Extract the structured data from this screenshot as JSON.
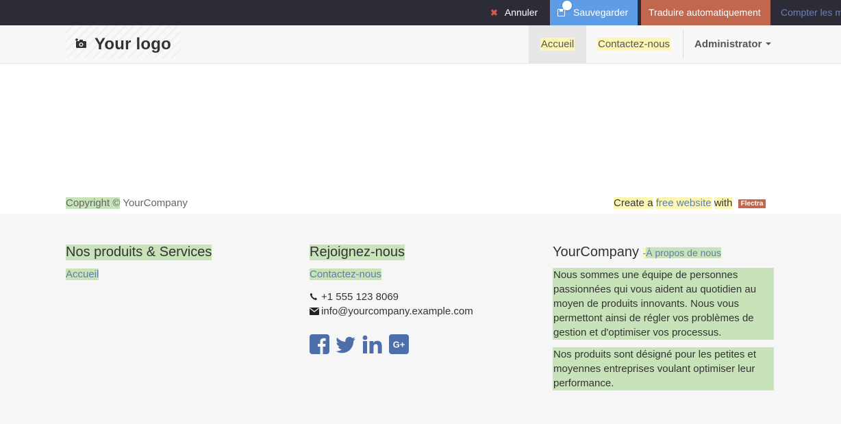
{
  "editor_bar": {
    "cancel_label": "Annuler",
    "save_label": "Sauvegarder",
    "translate_label": "Traduire automatiquement",
    "count_label": "Compter les m"
  },
  "header": {
    "logo_text": "Your logo",
    "nav": {
      "home": "Accueil",
      "contact": "Contactez-nous",
      "user": "Administrator"
    }
  },
  "footer": {
    "products": {
      "title": "Nos produits & Services",
      "link": "Accueil"
    },
    "join": {
      "title": "Rejoignez-nous",
      "link": "Contactez-nous",
      "phone": "+1 555 123 8069",
      "email": "info@yourcompany.example.com",
      "social_icons": [
        "facebook-icon",
        "twitter-icon",
        "linkedin-icon",
        "google-plus-icon"
      ]
    },
    "company": {
      "name": "YourCompany",
      "separator": "-",
      "about_link": "À propos de nous",
      "paragraph1": "Nous sommes une équipe de personnes passionnées qui vous aident au quotidien au moyen de produits innovants. Nous vous permettont ainsi de régler vos problèmes de gestion et d'optimiser vos processus.",
      "paragraph2": "Nos produits sont désigné pour les petites et moyennes entreprises voulant optimiser leur performance."
    },
    "copyright": {
      "prefix": "Copyright ©",
      "company": "YourCompany"
    },
    "credit": {
      "create_a": "Create a",
      "free_website": "free website",
      "with": "with",
      "brand": "Flectra"
    }
  },
  "colors": {
    "editor_bar_bg": "#2b2c35",
    "save_blue": "#5e9ce8",
    "translate_orange": "#c0674e",
    "highlight_green": "#c8e2b9",
    "highlight_yellow": "#fdf7b3",
    "social_blue": "#4d6ea8"
  }
}
